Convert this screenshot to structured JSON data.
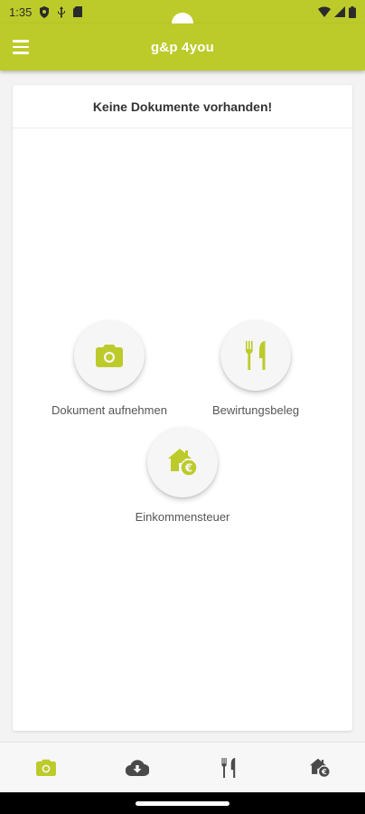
{
  "status_bar": {
    "time": "1:35",
    "left_icons": [
      "shield-icon",
      "usb-icon",
      "sim-card-icon"
    ],
    "right_icons": [
      "wifi-icon",
      "cell-signal-icon",
      "battery-icon"
    ]
  },
  "app_bar": {
    "title": "g&p 4you",
    "menu_icon": "menu-icon"
  },
  "colors": {
    "accent": "#bccb2a",
    "background": "#f3f3f3",
    "card": "#ffffff"
  },
  "main": {
    "empty_message": "Keine Dokumente vorhanden!",
    "actions": [
      {
        "icon": "camera-icon",
        "label": "Dokument aufnehmen"
      },
      {
        "icon": "restaurant-icon",
        "label": "Bewirtungsbeleg"
      },
      {
        "icon": "house-euro-icon",
        "label": "Einkommensteuer"
      }
    ]
  },
  "bottom_nav": {
    "items": [
      {
        "icon": "camera-icon",
        "active": true
      },
      {
        "icon": "cloud-download-icon",
        "active": false
      },
      {
        "icon": "restaurant-icon",
        "active": false
      },
      {
        "icon": "house-euro-icon",
        "active": false
      }
    ]
  }
}
